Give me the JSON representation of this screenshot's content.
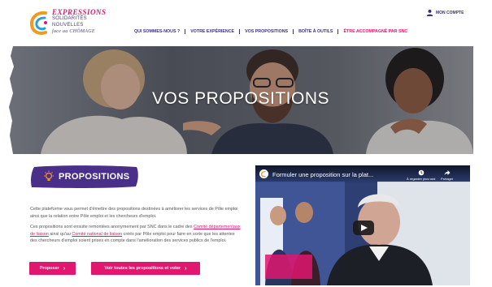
{
  "logo": {
    "title": "EXPRESSIONS",
    "line1": "SOLIDARITÉS",
    "line2": "NOUVELLES",
    "line3": "face au CHÔMAGE"
  },
  "account": {
    "label": "MON COMPTE"
  },
  "nav": {
    "items": [
      "QUI SOMMES-NOUS ?",
      "VOTRE EXPÉRIENCE",
      "VOS PROPOSITIONS",
      "BOÎTE À OUTILS",
      "ÊTRE ACCOMPAGNÉ PAR SNC"
    ]
  },
  "hero": {
    "title": "VOS PROPOSITIONS"
  },
  "section": {
    "badge": "PROPOSITIONS",
    "p1": "Cette plateforme vous permet d'émettre des propositions destinées à améliorer les services de Pôle emploi ainsi que la relation entre Pôle emploi et les chercheurs d'emploi.",
    "p2_a": "Ces propositions sont ensuite remontées anonymement par SNC dans le cadre des ",
    "p2_link1": "Comité départementaux de liaison",
    "p2_b": " ainsi qu'au ",
    "p2_link2": "Comité national de liaison",
    "p2_c": " créés par Pôle emploi pour faire en sorte que les attentes des chercheurs d'emploi soient prises en compte dans l'amélioration des services publics de l'emploi."
  },
  "buttons": {
    "propose": "Proposer",
    "view_all": "Voir toutes les propositions et voter",
    "chevron": "›"
  },
  "video": {
    "title": "Formuler une proposition sur la plat...",
    "watch_later": "À regarder plus tard",
    "share": "Partager"
  },
  "colors": {
    "brand_pink": "#e0166f",
    "brand_purple": "#3b2e86"
  }
}
